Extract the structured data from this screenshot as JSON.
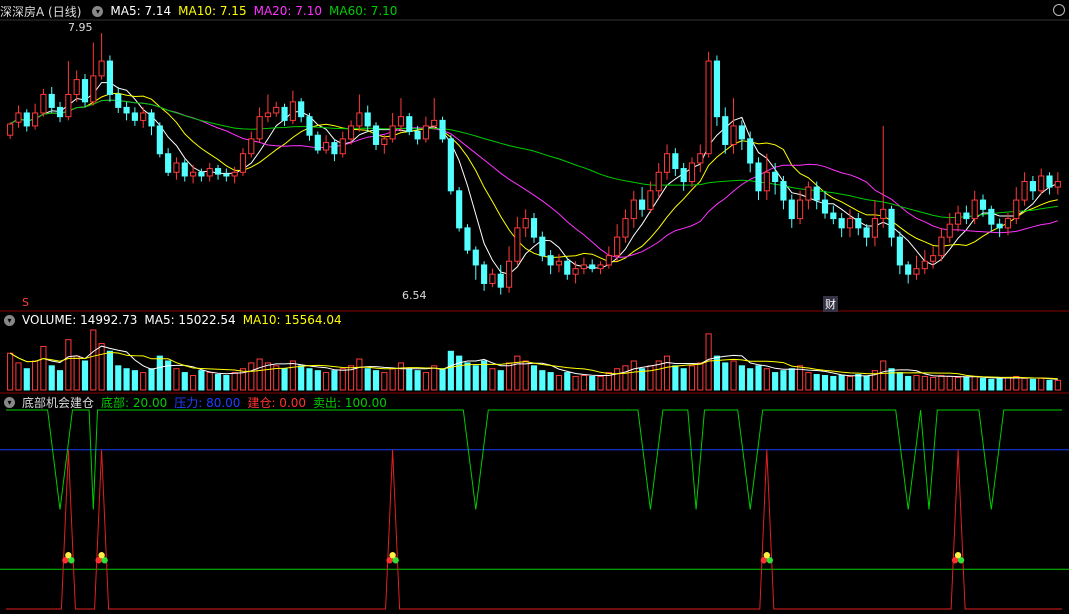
{
  "colors": {
    "up": "#ff3a3a",
    "down": "#54ffff",
    "ma5": "#ffffff",
    "ma10": "#ffff00",
    "ma20": "#ff33ff",
    "ma60": "#00cc00",
    "grid": "#8b0000",
    "blue": "#1e3cff"
  },
  "header": {
    "title": "深深房A (日线)",
    "ma5": "MA5: 7.14",
    "ma10": "MA10: 7.15",
    "ma20": "MA20: 7.10",
    "ma60": "MA60: 7.10"
  },
  "volume_header": {
    "title": "VOLUME: 14992.73",
    "ma5": "MA5: 15022.54",
    "ma10": "MA10: 15564.04"
  },
  "indicator_header": {
    "title": "底部机会建仓",
    "dibu": "底部: 20.00",
    "yali": "压力: 80.00",
    "jiancang": "建仓: 0.00",
    "maichu": "卖出: 100.00"
  },
  "annotations": {
    "high": "7.95",
    "low": "6.54",
    "s_marker": "S",
    "cai_marker": "财"
  },
  "chart_data": {
    "type": "candlestick",
    "ylim": [
      6.5,
      8.0
    ],
    "candles": [
      [
        7.4,
        7.46,
        7.38,
        7.47
      ],
      [
        7.47,
        7.52,
        7.44,
        7.56
      ],
      [
        7.52,
        7.45,
        7.42,
        7.54
      ],
      [
        7.45,
        7.52,
        7.43,
        7.57
      ],
      [
        7.52,
        7.62,
        7.5,
        7.65
      ],
      [
        7.62,
        7.55,
        7.52,
        7.66
      ],
      [
        7.55,
        7.5,
        7.47,
        7.58
      ],
      [
        7.5,
        7.62,
        7.48,
        7.8
      ],
      [
        7.62,
        7.7,
        7.58,
        7.75
      ],
      [
        7.7,
        7.58,
        7.55,
        7.73
      ],
      [
        7.58,
        7.72,
        7.56,
        7.9
      ],
      [
        7.72,
        7.8,
        7.7,
        7.95
      ],
      [
        7.8,
        7.62,
        7.58,
        7.83
      ],
      [
        7.62,
        7.55,
        7.52,
        7.66
      ],
      [
        7.55,
        7.52,
        7.48,
        7.58
      ],
      [
        7.52,
        7.48,
        7.45,
        7.55
      ],
      [
        7.48,
        7.52,
        7.44,
        7.55
      ],
      [
        7.52,
        7.45,
        7.4,
        7.54
      ],
      [
        7.45,
        7.3,
        7.28,
        7.47
      ],
      [
        7.3,
        7.2,
        7.18,
        7.33
      ],
      [
        7.2,
        7.25,
        7.16,
        7.28
      ],
      [
        7.25,
        7.18,
        7.15,
        7.27
      ],
      [
        7.18,
        7.2,
        7.14,
        7.24
      ],
      [
        7.2,
        7.18,
        7.15,
        7.22
      ],
      [
        7.18,
        7.22,
        7.15,
        7.25
      ],
      [
        7.22,
        7.19,
        7.16,
        7.24
      ],
      [
        7.19,
        7.18,
        7.15,
        7.22
      ],
      [
        7.18,
        7.2,
        7.14,
        7.23
      ],
      [
        7.2,
        7.3,
        7.18,
        7.33
      ],
      [
        7.3,
        7.38,
        7.28,
        7.42
      ],
      [
        7.38,
        7.5,
        7.36,
        7.55
      ],
      [
        7.5,
        7.52,
        7.47,
        7.62
      ],
      [
        7.52,
        7.55,
        7.5,
        7.58
      ],
      [
        7.55,
        7.48,
        7.45,
        7.57
      ],
      [
        7.48,
        7.58,
        7.46,
        7.64
      ],
      [
        7.58,
        7.5,
        7.47,
        7.6
      ],
      [
        7.5,
        7.4,
        7.37,
        7.52
      ],
      [
        7.4,
        7.32,
        7.3,
        7.42
      ],
      [
        7.32,
        7.36,
        7.3,
        7.4
      ],
      [
        7.36,
        7.3,
        7.26,
        7.38
      ],
      [
        7.3,
        7.38,
        7.28,
        7.42
      ],
      [
        7.38,
        7.45,
        7.35,
        7.48
      ],
      [
        7.45,
        7.52,
        7.42,
        7.62
      ],
      [
        7.52,
        7.45,
        7.42,
        7.56
      ],
      [
        7.45,
        7.35,
        7.32,
        7.47
      ],
      [
        7.35,
        7.38,
        7.3,
        7.4
      ],
      [
        7.38,
        7.45,
        7.36,
        7.52
      ],
      [
        7.45,
        7.5,
        7.42,
        7.6
      ],
      [
        7.5,
        7.42,
        7.4,
        7.52
      ],
      [
        7.42,
        7.38,
        7.35,
        7.45
      ],
      [
        7.38,
        7.45,
        7.36,
        7.5
      ],
      [
        7.45,
        7.48,
        7.43,
        7.6
      ],
      [
        7.48,
        7.38,
        7.36,
        7.5
      ],
      [
        7.38,
        7.1,
        7.08,
        7.4
      ],
      [
        7.1,
        6.9,
        6.88,
        7.12
      ],
      [
        6.9,
        6.78,
        6.76,
        6.92
      ],
      [
        6.78,
        6.7,
        6.62,
        6.8
      ],
      [
        6.7,
        6.6,
        6.56,
        6.72
      ],
      [
        6.6,
        6.65,
        6.58,
        6.68
      ],
      [
        6.65,
        6.58,
        6.54,
        6.7
      ],
      [
        6.58,
        6.72,
        6.55,
        6.8
      ],
      [
        6.72,
        6.9,
        6.7,
        6.96
      ],
      [
        6.9,
        6.95,
        6.85,
        7.0
      ],
      [
        6.95,
        6.85,
        6.82,
        6.98
      ],
      [
        6.85,
        6.75,
        6.72,
        6.88
      ],
      [
        6.75,
        6.7,
        6.65,
        6.78
      ],
      [
        6.7,
        6.72,
        6.66,
        6.76
      ],
      [
        6.72,
        6.65,
        6.62,
        6.74
      ],
      [
        6.65,
        6.68,
        6.6,
        6.72
      ],
      [
        6.68,
        6.7,
        6.65,
        6.74
      ],
      [
        6.7,
        6.68,
        6.66,
        6.73
      ],
      [
        6.68,
        6.7,
        6.65,
        6.72
      ],
      [
        6.7,
        6.75,
        6.68,
        6.8
      ],
      [
        6.75,
        6.85,
        6.72,
        6.92
      ],
      [
        6.85,
        6.95,
        6.82,
        7.0
      ],
      [
        6.95,
        7.05,
        6.9,
        7.1
      ],
      [
        7.05,
        7.0,
        6.96,
        7.12
      ],
      [
        7.0,
        7.1,
        6.98,
        7.15
      ],
      [
        7.1,
        7.2,
        7.06,
        7.25
      ],
      [
        7.2,
        7.3,
        7.16,
        7.35
      ],
      [
        7.3,
        7.22,
        7.18,
        7.33
      ],
      [
        7.22,
        7.15,
        7.1,
        7.25
      ],
      [
        7.15,
        7.25,
        7.12,
        7.28
      ],
      [
        7.25,
        7.3,
        7.2,
        7.35
      ],
      [
        7.3,
        7.8,
        7.28,
        7.85
      ],
      [
        7.8,
        7.5,
        7.45,
        7.83
      ],
      [
        7.5,
        7.35,
        7.3,
        7.55
      ],
      [
        7.35,
        7.45,
        7.3,
        7.6
      ],
      [
        7.45,
        7.38,
        7.32,
        7.48
      ],
      [
        7.38,
        7.25,
        7.2,
        7.42
      ],
      [
        7.25,
        7.1,
        7.05,
        7.28
      ],
      [
        7.1,
        7.2,
        7.05,
        7.3
      ],
      [
        7.2,
        7.15,
        7.08,
        7.25
      ],
      [
        7.15,
        7.05,
        7.0,
        7.18
      ],
      [
        7.05,
        6.95,
        6.9,
        7.08
      ],
      [
        6.95,
        7.05,
        6.92,
        7.1
      ],
      [
        7.05,
        7.12,
        7.0,
        7.15
      ],
      [
        7.12,
        7.05,
        7.0,
        7.15
      ],
      [
        7.05,
        6.98,
        6.95,
        7.1
      ],
      [
        6.98,
        6.95,
        6.92,
        7.02
      ],
      [
        6.95,
        6.9,
        6.85,
        6.98
      ],
      [
        6.9,
        6.95,
        6.85,
        7.0
      ],
      [
        6.95,
        6.9,
        6.86,
        6.98
      ],
      [
        6.9,
        6.85,
        6.8,
        6.92
      ],
      [
        6.85,
        6.95,
        6.8,
        7.05
      ],
      [
        6.95,
        7.0,
        6.9,
        7.45
      ],
      [
        7.0,
        6.85,
        6.8,
        7.02
      ],
      [
        6.85,
        6.7,
        6.65,
        6.88
      ],
      [
        6.7,
        6.65,
        6.6,
        6.72
      ],
      [
        6.65,
        6.68,
        6.62,
        6.75
      ],
      [
        6.68,
        6.72,
        6.65,
        6.78
      ],
      [
        6.72,
        6.75,
        6.68,
        6.8
      ],
      [
        6.75,
        6.85,
        6.72,
        6.9
      ],
      [
        6.85,
        6.92,
        6.82,
        6.98
      ],
      [
        6.92,
        6.98,
        6.88,
        7.02
      ],
      [
        6.98,
        6.95,
        6.92,
        7.02
      ],
      [
        6.95,
        7.05,
        6.92,
        7.1
      ],
      [
        7.05,
        7.0,
        6.96,
        7.08
      ],
      [
        7.0,
        6.92,
        6.88,
        7.02
      ],
      [
        6.92,
        6.9,
        6.85,
        6.95
      ],
      [
        6.9,
        6.95,
        6.86,
        6.98
      ],
      [
        6.95,
        7.05,
        6.92,
        7.12
      ],
      [
        7.05,
        7.15,
        7.02,
        7.2
      ],
      [
        7.15,
        7.1,
        7.05,
        7.18
      ],
      [
        7.1,
        7.18,
        7.08,
        7.22
      ],
      [
        7.18,
        7.12,
        7.08,
        7.2
      ],
      [
        7.12,
        7.15,
        7.08,
        7.2
      ]
    ],
    "volume": [
      38,
      28,
      22,
      30,
      45,
      25,
      20,
      52,
      35,
      30,
      62,
      48,
      40,
      25,
      22,
      20,
      18,
      22,
      35,
      30,
      22,
      18,
      15,
      20,
      18,
      16,
      15,
      18,
      22,
      28,
      32,
      28,
      25,
      22,
      30,
      25,
      22,
      20,
      18,
      20,
      22,
      25,
      32,
      22,
      20,
      18,
      22,
      28,
      22,
      20,
      18,
      25,
      22,
      40,
      35,
      28,
      25,
      30,
      22,
      20,
      28,
      35,
      30,
      25,
      20,
      18,
      15,
      18,
      14,
      15,
      14,
      14,
      18,
      22,
      25,
      30,
      22,
      25,
      30,
      35,
      25,
      22,
      25,
      28,
      58,
      35,
      28,
      30,
      25,
      22,
      25,
      22,
      18,
      20,
      22,
      25,
      18,
      16,
      15,
      14,
      15,
      14,
      16,
      14,
      20,
      30,
      22,
      18,
      14,
      15,
      14,
      13,
      15,
      14,
      13,
      13,
      14,
      12,
      11,
      12,
      13,
      14,
      12,
      11,
      12,
      10,
      10
    ],
    "indicator": {
      "dibu": 20.0,
      "yali": 80.0,
      "jiancang": 0.0,
      "maichu": 100.0,
      "green_dips": [
        [
          5,
          8
        ],
        [
          10,
          11
        ],
        [
          55,
          58
        ],
        [
          76,
          79
        ],
        [
          82,
          84
        ],
        [
          88,
          91
        ],
        [
          107,
          110
        ],
        [
          110,
          112
        ],
        [
          117,
          120
        ]
      ],
      "red_peaks": [
        7,
        11,
        46,
        91,
        114
      ]
    }
  }
}
